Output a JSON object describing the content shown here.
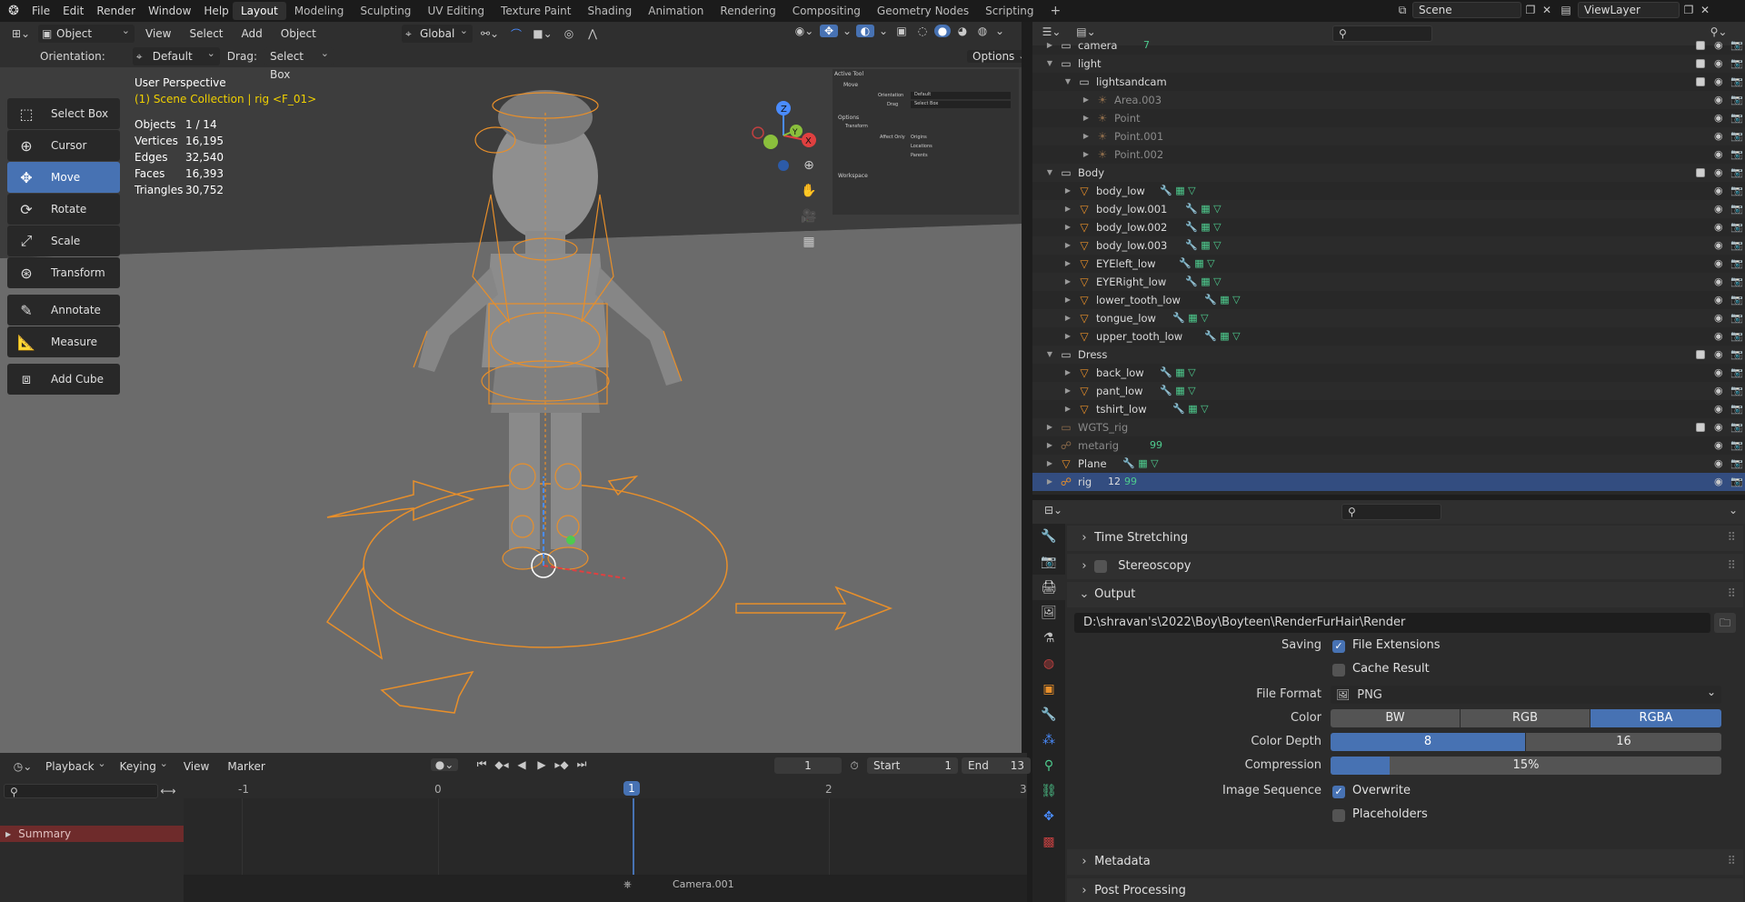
{
  "topbar": {
    "menus": [
      "File",
      "Edit",
      "Render",
      "Window",
      "Help"
    ],
    "workspaces": [
      "Layout",
      "Modeling",
      "Sculpting",
      "UV Editing",
      "Texture Paint",
      "Shading",
      "Animation",
      "Rendering",
      "Compositing",
      "Geometry Nodes",
      "Scripting"
    ],
    "active_workspace": "Layout",
    "scene": "Scene",
    "view_layer": "ViewLayer"
  },
  "viewport": {
    "mode": "Object Mode",
    "menus": [
      "View",
      "Select",
      "Add",
      "Object"
    ],
    "transform_orientation": "Global",
    "orientation_label": "Orientation:",
    "orientation_value": "Default",
    "drag_label": "Drag:",
    "drag_value": "Select Box",
    "options_label": "Options",
    "perspective": "User Perspective",
    "collection_info": "(1) Scene Collection | rig <F_01>",
    "stats": [
      {
        "label": "Objects",
        "value": "1 / 14"
      },
      {
        "label": "Vertices",
        "value": "16,195"
      },
      {
        "label": "Edges",
        "value": "32,540"
      },
      {
        "label": "Faces",
        "value": "16,393"
      },
      {
        "label": "Triangles",
        "value": "30,752"
      }
    ],
    "tools": [
      {
        "label": "Select Box",
        "icon": "select-box-icon"
      },
      {
        "label": "Cursor",
        "icon": "cursor-icon"
      },
      {
        "label": "Move",
        "icon": "move-icon",
        "active": true
      },
      {
        "label": "Rotate",
        "icon": "rotate-icon"
      },
      {
        "label": "Scale",
        "icon": "scale-icon"
      },
      {
        "label": "Transform",
        "icon": "transform-icon"
      },
      {
        "label": "Annotate",
        "icon": "annotate-icon"
      },
      {
        "label": "Measure",
        "icon": "measure-icon"
      },
      {
        "label": "Add Cube",
        "icon": "add-cube-icon"
      }
    ],
    "npanel": {
      "active_tool": "Active Tool",
      "move": "Move",
      "orientation": "Orientation",
      "orientation_val": "Default",
      "drag": "Drag",
      "drag_val": "Select Box",
      "options": "Options",
      "transform": "Transform",
      "affect_only": "Affect Only",
      "origins": "Origins",
      "locations": "Locations",
      "parents": "Parents",
      "workspace": "Workspace",
      "tabs": [
        "Item",
        "Tool",
        "View"
      ]
    },
    "gizmo": {
      "x": "X",
      "y": "Y",
      "z": "Z"
    }
  },
  "timeline": {
    "menus": [
      "Playback",
      "Keying",
      "View",
      "Marker"
    ],
    "current_frame": "1",
    "start_label": "Start",
    "start": "1",
    "end_label": "End",
    "end": "13",
    "ruler": [
      "-1",
      "0",
      "1",
      "2",
      "3"
    ],
    "summary": "Summary",
    "marker": "Camera.001"
  },
  "outliner": {
    "rows": [
      {
        "name": "camera",
        "indent": 1,
        "type": "collection",
        "badge": "7"
      },
      {
        "name": "light",
        "indent": 1,
        "type": "collection",
        "expanded": true
      },
      {
        "name": "lightsandcam",
        "indent": 2,
        "type": "collection",
        "expanded": true
      },
      {
        "name": "Area.003",
        "indent": 3,
        "type": "light",
        "dim": true
      },
      {
        "name": "Point",
        "indent": 3,
        "type": "light",
        "dim": true
      },
      {
        "name": "Point.001",
        "indent": 3,
        "type": "light",
        "dim": true
      },
      {
        "name": "Point.002",
        "indent": 3,
        "type": "light",
        "dim": true
      },
      {
        "name": "Body",
        "indent": 1,
        "type": "collection",
        "expanded": true
      },
      {
        "name": "body_low",
        "indent": 2,
        "type": "mesh"
      },
      {
        "name": "body_low.001",
        "indent": 2,
        "type": "mesh"
      },
      {
        "name": "body_low.002",
        "indent": 2,
        "type": "mesh"
      },
      {
        "name": "body_low.003",
        "indent": 2,
        "type": "mesh"
      },
      {
        "name": "EYEleft_low",
        "indent": 2,
        "type": "mesh"
      },
      {
        "name": "EYERight_low",
        "indent": 2,
        "type": "mesh"
      },
      {
        "name": "lower_tooth_low",
        "indent": 2,
        "type": "mesh"
      },
      {
        "name": "tongue_low",
        "indent": 2,
        "type": "mesh"
      },
      {
        "name": "upper_tooth_low",
        "indent": 2,
        "type": "mesh"
      },
      {
        "name": "Dress",
        "indent": 1,
        "type": "collection",
        "expanded": true
      },
      {
        "name": "back_low",
        "indent": 2,
        "type": "mesh"
      },
      {
        "name": "pant_low",
        "indent": 2,
        "type": "mesh"
      },
      {
        "name": "tshirt_low",
        "indent": 2,
        "type": "mesh"
      },
      {
        "name": "WGTS_rig",
        "indent": 1,
        "type": "collection",
        "dim": true
      },
      {
        "name": "metarig",
        "indent": 1,
        "type": "armature",
        "dim": true,
        "badge": "99"
      },
      {
        "name": "Plane",
        "indent": 1,
        "type": "mesh"
      },
      {
        "name": "rig",
        "indent": 1,
        "type": "armature",
        "selected": true,
        "badge": "99",
        "badge2": "12"
      }
    ]
  },
  "properties": {
    "panels": {
      "time_stretching": "Time Stretching",
      "stereoscopy": "Stereoscopy",
      "output": "Output",
      "metadata": "Metadata",
      "post_processing": "Post Processing"
    },
    "output_path": "D:\\shravan's\\2022\\Boy\\Boyteen\\RenderFurHair\\Render",
    "saving_label": "Saving",
    "file_extensions": "File Extensions",
    "cache_result": "Cache Result",
    "file_format_label": "File Format",
    "file_format": "PNG",
    "color_label": "Color",
    "color_options": [
      "BW",
      "RGB",
      "RGBA"
    ],
    "color_selected": "RGBA",
    "color_depth_label": "Color Depth",
    "color_depth_options": [
      "8",
      "16"
    ],
    "color_depth_selected": "8",
    "compression_label": "Compression",
    "compression": "15%",
    "compression_fraction": 0.15,
    "image_sequence_label": "Image Sequence",
    "overwrite": "Overwrite",
    "placeholders": "Placeholders"
  }
}
